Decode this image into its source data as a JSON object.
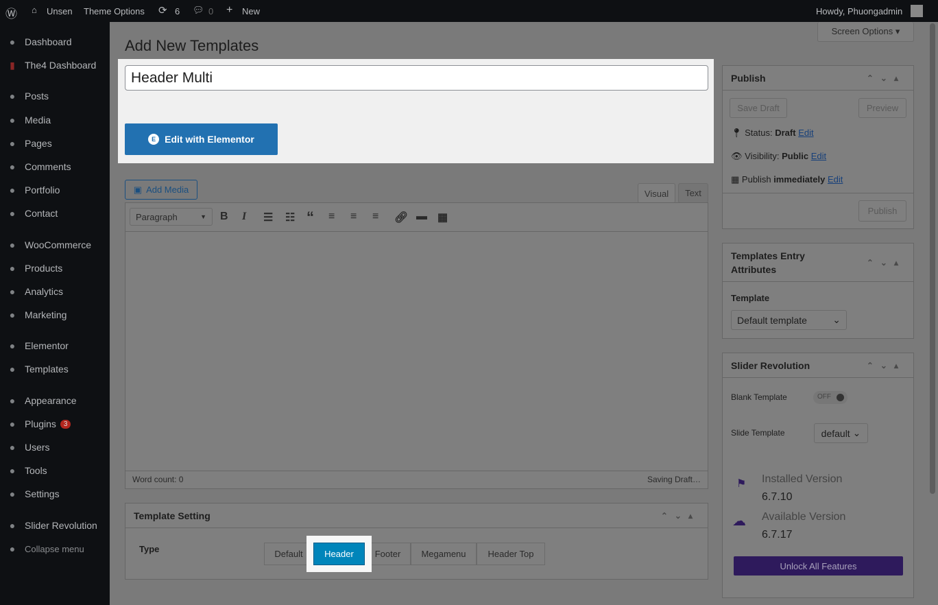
{
  "adminbar": {
    "site": "Unsen",
    "theme_options": "Theme Options",
    "updates": "6",
    "comments": "0",
    "new": "New",
    "howdy": "Howdy, Phuongadmin"
  },
  "sidebar": {
    "items": [
      {
        "label": "Dashboard",
        "icon": "dashboard-icon"
      },
      {
        "label": "The4 Dashboard",
        "icon": "the4-icon"
      },
      {
        "label": "Posts",
        "icon": "pin-icon"
      },
      {
        "label": "Media",
        "icon": "media-icon"
      },
      {
        "label": "Pages",
        "icon": "pages-icon"
      },
      {
        "label": "Comments",
        "icon": "comments-icon"
      },
      {
        "label": "Portfolio",
        "icon": "folder-icon"
      },
      {
        "label": "Contact",
        "icon": "mail-icon"
      },
      {
        "label": "WooCommerce",
        "icon": "woo-icon"
      },
      {
        "label": "Products",
        "icon": "products-icon"
      },
      {
        "label": "Analytics",
        "icon": "analytics-icon"
      },
      {
        "label": "Marketing",
        "icon": "megaphone-icon"
      },
      {
        "label": "Elementor",
        "icon": "elementor-icon"
      },
      {
        "label": "Templates",
        "icon": "folder-icon"
      },
      {
        "label": "Appearance",
        "icon": "brush-icon"
      },
      {
        "label": "Plugins",
        "icon": "plugin-icon",
        "badge": "3"
      },
      {
        "label": "Users",
        "icon": "user-icon"
      },
      {
        "label": "Tools",
        "icon": "wrench-icon"
      },
      {
        "label": "Settings",
        "icon": "settings-icon"
      },
      {
        "label": "Slider Revolution",
        "icon": "refresh-icon"
      },
      {
        "label": "Collapse menu",
        "icon": "collapse-icon"
      }
    ]
  },
  "screen_options": "Screen Options ▾",
  "page_title": "Add New Templates",
  "title_value": "Header Multi",
  "edit_elementor": "Edit with Elementor",
  "editor": {
    "add_media": "Add Media",
    "tab_visual": "Visual",
    "tab_text": "Text",
    "format": "Paragraph",
    "word_count": "Word count: 0",
    "saving": "Saving Draft…"
  },
  "publish": {
    "title": "Publish",
    "save_draft": "Save Draft",
    "preview": "Preview",
    "status_label": "Status:",
    "status": "Draft",
    "visibility_label": "Visibility:",
    "visibility": "Public",
    "publish_label": "Publish",
    "publish_when": "immediately",
    "edit": "Edit",
    "publish_btn": "Publish"
  },
  "attributes": {
    "title": "Templates Entry Attributes",
    "template_label": "Template",
    "template_value": "Default template"
  },
  "slider": {
    "title": "Slider Revolution",
    "blank": "Blank Template",
    "toggle": "OFF",
    "slide_template": "Slide Template",
    "slide_value": "default",
    "installed_label": "Installed Version",
    "installed": "6.7.10",
    "available_label": "Available Version",
    "available": "6.7.17",
    "unlock": "Unlock All Features"
  },
  "template_setting": {
    "title": "Template Setting",
    "type_label": "Type",
    "options": [
      "Default",
      "Header",
      "Footer",
      "Megamenu",
      "Header Top"
    ],
    "selected": "Header"
  },
  "colors": {
    "accent": "#2271b1",
    "selected": "#0085ba",
    "unlock": "#2e1a5c"
  }
}
